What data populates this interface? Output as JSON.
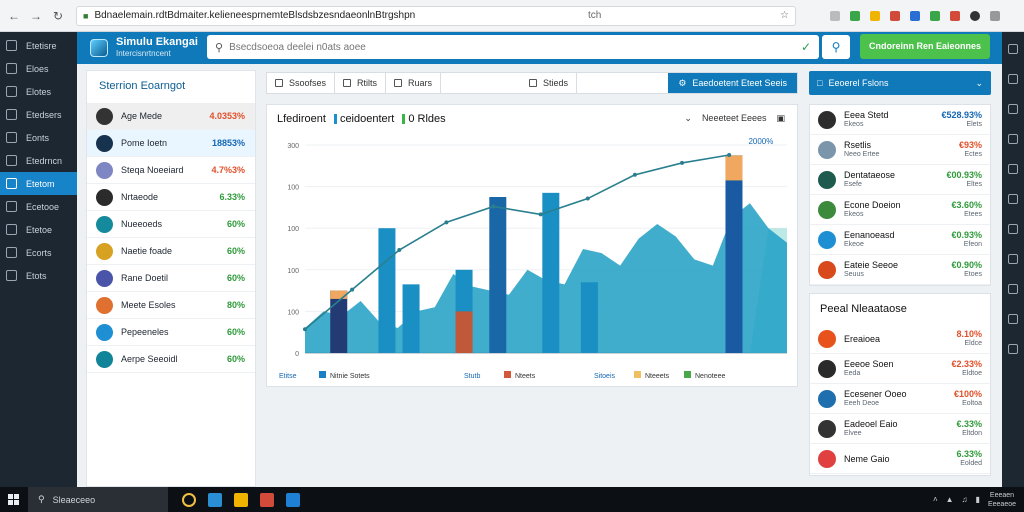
{
  "browser": {
    "url": "Bdnaelemain.rdtBdmaiter.kelieneesprnemteBlsdsbzesndaeonlnBtrgshpn",
    "toolbar_label": "tch"
  },
  "app": {
    "title": "Simulu Ekangai",
    "subtitle": "Intercisnrtncent",
    "search_placeholder": "Bsecdsoeoa deelei n0ats aoee",
    "cta_label": "Cndoreinn Ren Eaieonnes"
  },
  "sidebar": {
    "items": [
      {
        "label": "Etetisre",
        "active": false
      },
      {
        "label": "Eloes",
        "active": false
      },
      {
        "label": "Elotes",
        "active": false
      },
      {
        "label": "Etedsers",
        "active": false
      },
      {
        "label": "Eonts",
        "active": false
      },
      {
        "label": "Etedrncn",
        "active": false
      },
      {
        "label": "Etetom",
        "active": true
      },
      {
        "label": "Ecetooe",
        "active": false
      },
      {
        "label": "Etetoe",
        "active": false
      },
      {
        "label": "Ecorts",
        "active": false
      },
      {
        "label": "Etots",
        "active": false
      }
    ]
  },
  "left_panel": {
    "title": "Sterrion Eoarngot",
    "rows": [
      {
        "label": "Age Mede",
        "value": "4.0353%",
        "color": "#e0502a",
        "avatar": "#333333",
        "style": "highlight"
      },
      {
        "label": "Pome Ioetn",
        "value": "18853%",
        "color": "#1467b5",
        "avatar": "#16324f",
        "style": "blue"
      },
      {
        "label": "Steqa Noeeiard",
        "value": "4.7%3%",
        "color": "#e0502a",
        "avatar": "#7f86c4",
        "style": "none"
      },
      {
        "label": "Nrtaeode",
        "value": "6.33%",
        "color": "#2f9a3a",
        "avatar": "#2b2b2b",
        "style": "none"
      },
      {
        "label": "Nueeoeds",
        "value": "60%",
        "color": "#2f9a3a",
        "avatar": "#158a9c",
        "style": "none"
      },
      {
        "label": "Naetie foade",
        "value": "60%",
        "color": "#2f9a3a",
        "avatar": "#d7a122",
        "style": "none"
      },
      {
        "label": "Rane Doetil",
        "value": "60%",
        "color": "#2f9a3a",
        "avatar": "#4a54a8",
        "style": "none"
      },
      {
        "label": "Meete Esoles",
        "value": "80%",
        "color": "#2f9a3a",
        "avatar": "#e0702f",
        "style": "none"
      },
      {
        "label": "Pepeeneles",
        "value": "60%",
        "color": "#2f9a3a",
        "avatar": "#1f8fd4",
        "style": "none"
      },
      {
        "label": "Aerpe Seeoidl",
        "value": "60%",
        "color": "#2f9a3a",
        "avatar": "#12849a",
        "style": "none"
      }
    ]
  },
  "toolbar": {
    "buttons": [
      "Ssoofses",
      "Rtilts",
      "Ruars",
      "Stieds"
    ],
    "primary": "Eaedoetent Eteet Seeis"
  },
  "chart_data": {
    "type": "bar",
    "title": "Lfediroent",
    "title_segments": [
      {
        "text": "ceidoentert",
        "color": "#1a8fd1"
      },
      {
        "text": "0 Rldes",
        "color": "#39b54a"
      }
    ],
    "header_right": [
      "Neeeteet Eeees"
    ],
    "annotation": "2000%",
    "y_ticks": [
      "300",
      "100",
      "100",
      "100",
      "100",
      "0"
    ],
    "legend": [
      {
        "label": "Etitse",
        "color": "#ffffff"
      },
      {
        "label": "Nitnie Sotets",
        "color": "#1a7fc4"
      },
      {
        "label": "Stutb",
        "color": "#ffffff"
      },
      {
        "label": "Nteets",
        "color": "#d25a3a"
      },
      {
        "label": "Sitoeis",
        "color": "#ffffff"
      },
      {
        "label": "Nteeets",
        "color": "#f0c060"
      },
      {
        "label": "Nenoteee",
        "color": "#4aa84a"
      }
    ],
    "area": [
      0.12,
      0.2,
      0.18,
      0.25,
      0.15,
      0.12,
      0.2,
      0.22,
      0.38,
      0.32,
      0.3,
      0.28,
      0.4,
      0.35,
      0.33,
      0.5,
      0.48,
      0.42,
      0.55,
      0.62,
      0.56,
      0.45,
      0.42,
      0.65,
      0.72,
      0.6,
      0.53
    ],
    "light_area": [
      0,
      0,
      0,
      0,
      0,
      0,
      0,
      0,
      0,
      0,
      0,
      0,
      0,
      0,
      0,
      0,
      0,
      0,
      0,
      0,
      0,
      0,
      0,
      0,
      0,
      0.6,
      0.6
    ],
    "bars": [
      {
        "x": 0.07,
        "value": 0.3,
        "color": "#233b74",
        "top_color": "#f0a860",
        "top": 0.04
      },
      {
        "x": 0.17,
        "value": 0.6,
        "color": "#1a8fc4"
      },
      {
        "x": 0.22,
        "value": 0.33,
        "color": "#1a8fc4"
      },
      {
        "x": 0.33,
        "value": 0.4,
        "color": "#1a8fc4"
      },
      {
        "x": 0.33,
        "value": 0.2,
        "color": "#c0583a"
      },
      {
        "x": 0.4,
        "value": 0.75,
        "color": "#1a67a8"
      },
      {
        "x": 0.51,
        "value": 0.77,
        "color": "#1a8fc4"
      },
      {
        "x": 0.59,
        "value": 0.34,
        "color": "#1a8fc4"
      },
      {
        "x": 0.89,
        "value": 0.95,
        "color": "#1a5aa3",
        "top_color": "#f0a860",
        "top": 0.12,
        "mid_color": "#4aa84a",
        "mid": 0.12
      }
    ],
    "line": [
      0.12,
      0.32,
      0.52,
      0.66,
      0.74,
      0.7,
      0.78,
      0.9,
      0.96,
      1.0
    ]
  },
  "right_panel": {
    "select_label": "Eeoerel Fslons",
    "top_rows": [
      {
        "name": "Eeea Stetd",
        "sub": "Ekeos",
        "value": "€528.93%",
        "sub2": "Elets",
        "color": "#1467b5",
        "avatar": "#2d2d2d"
      },
      {
        "name": "Rsetlis",
        "sub": "Neeo Ertee",
        "value": "€93%",
        "sub2": "Ectes",
        "color": "#e0502a",
        "avatar": "#7b95aa"
      },
      {
        "name": "Dentataeose",
        "sub": "Esefe",
        "value": "€00.93%",
        "sub2": "Eltes",
        "color": "#2f9a3a",
        "avatar": "#1f5a4f"
      },
      {
        "name": "Econe Doeion",
        "sub": "Ekeos",
        "value": "€3.60%",
        "sub2": "Etees",
        "color": "#2f9a3a",
        "avatar": "#3c8a3c"
      },
      {
        "name": "Eenanoeasd",
        "sub": "Ekeoe",
        "value": "€0.93%",
        "sub2": "Efeon",
        "color": "#2f9a3a",
        "avatar": "#1f8fd4"
      },
      {
        "name": "Eateie Seeoe",
        "sub": "Seuus",
        "value": "€0.90%",
        "sub2": "Etoes",
        "color": "#2f9a3a",
        "avatar": "#d8491c"
      }
    ],
    "second_title": "Peeal Nleaataose",
    "bottom_rows": [
      {
        "name": "Ereaioea",
        "sub": "",
        "value": "8.10%",
        "sub2": "Eldce",
        "color": "#e0502a",
        "avatar": "#e8521c"
      },
      {
        "name": "Eeeoe Soen",
        "sub": "Eeda",
        "value": "€2.33%",
        "sub2": "Eldtoe",
        "color": "#e0502a",
        "avatar": "#2a2a2a"
      },
      {
        "name": "Ecesener Ooeo",
        "sub": "Eeeh Deoe",
        "value": "€100%",
        "sub2": "Eoltoa",
        "color": "#e0502a",
        "avatar": "#1f6fae"
      },
      {
        "name": "Eadeoel Eaio",
        "sub": "Elvee",
        "value": "€.33%",
        "sub2": "Eltdon",
        "color": "#2f9a3a",
        "avatar": "#333333"
      },
      {
        "name": "Neme Gaio",
        "sub": "",
        "value": "6.33%",
        "sub2": "Eolded",
        "color": "#2f9a3a",
        "avatar": "#e04040"
      }
    ]
  },
  "taskbar": {
    "search_label": "Sleaeceeo",
    "clock_time": "Eeeaen",
    "clock_date": "Eeeaeoe"
  }
}
